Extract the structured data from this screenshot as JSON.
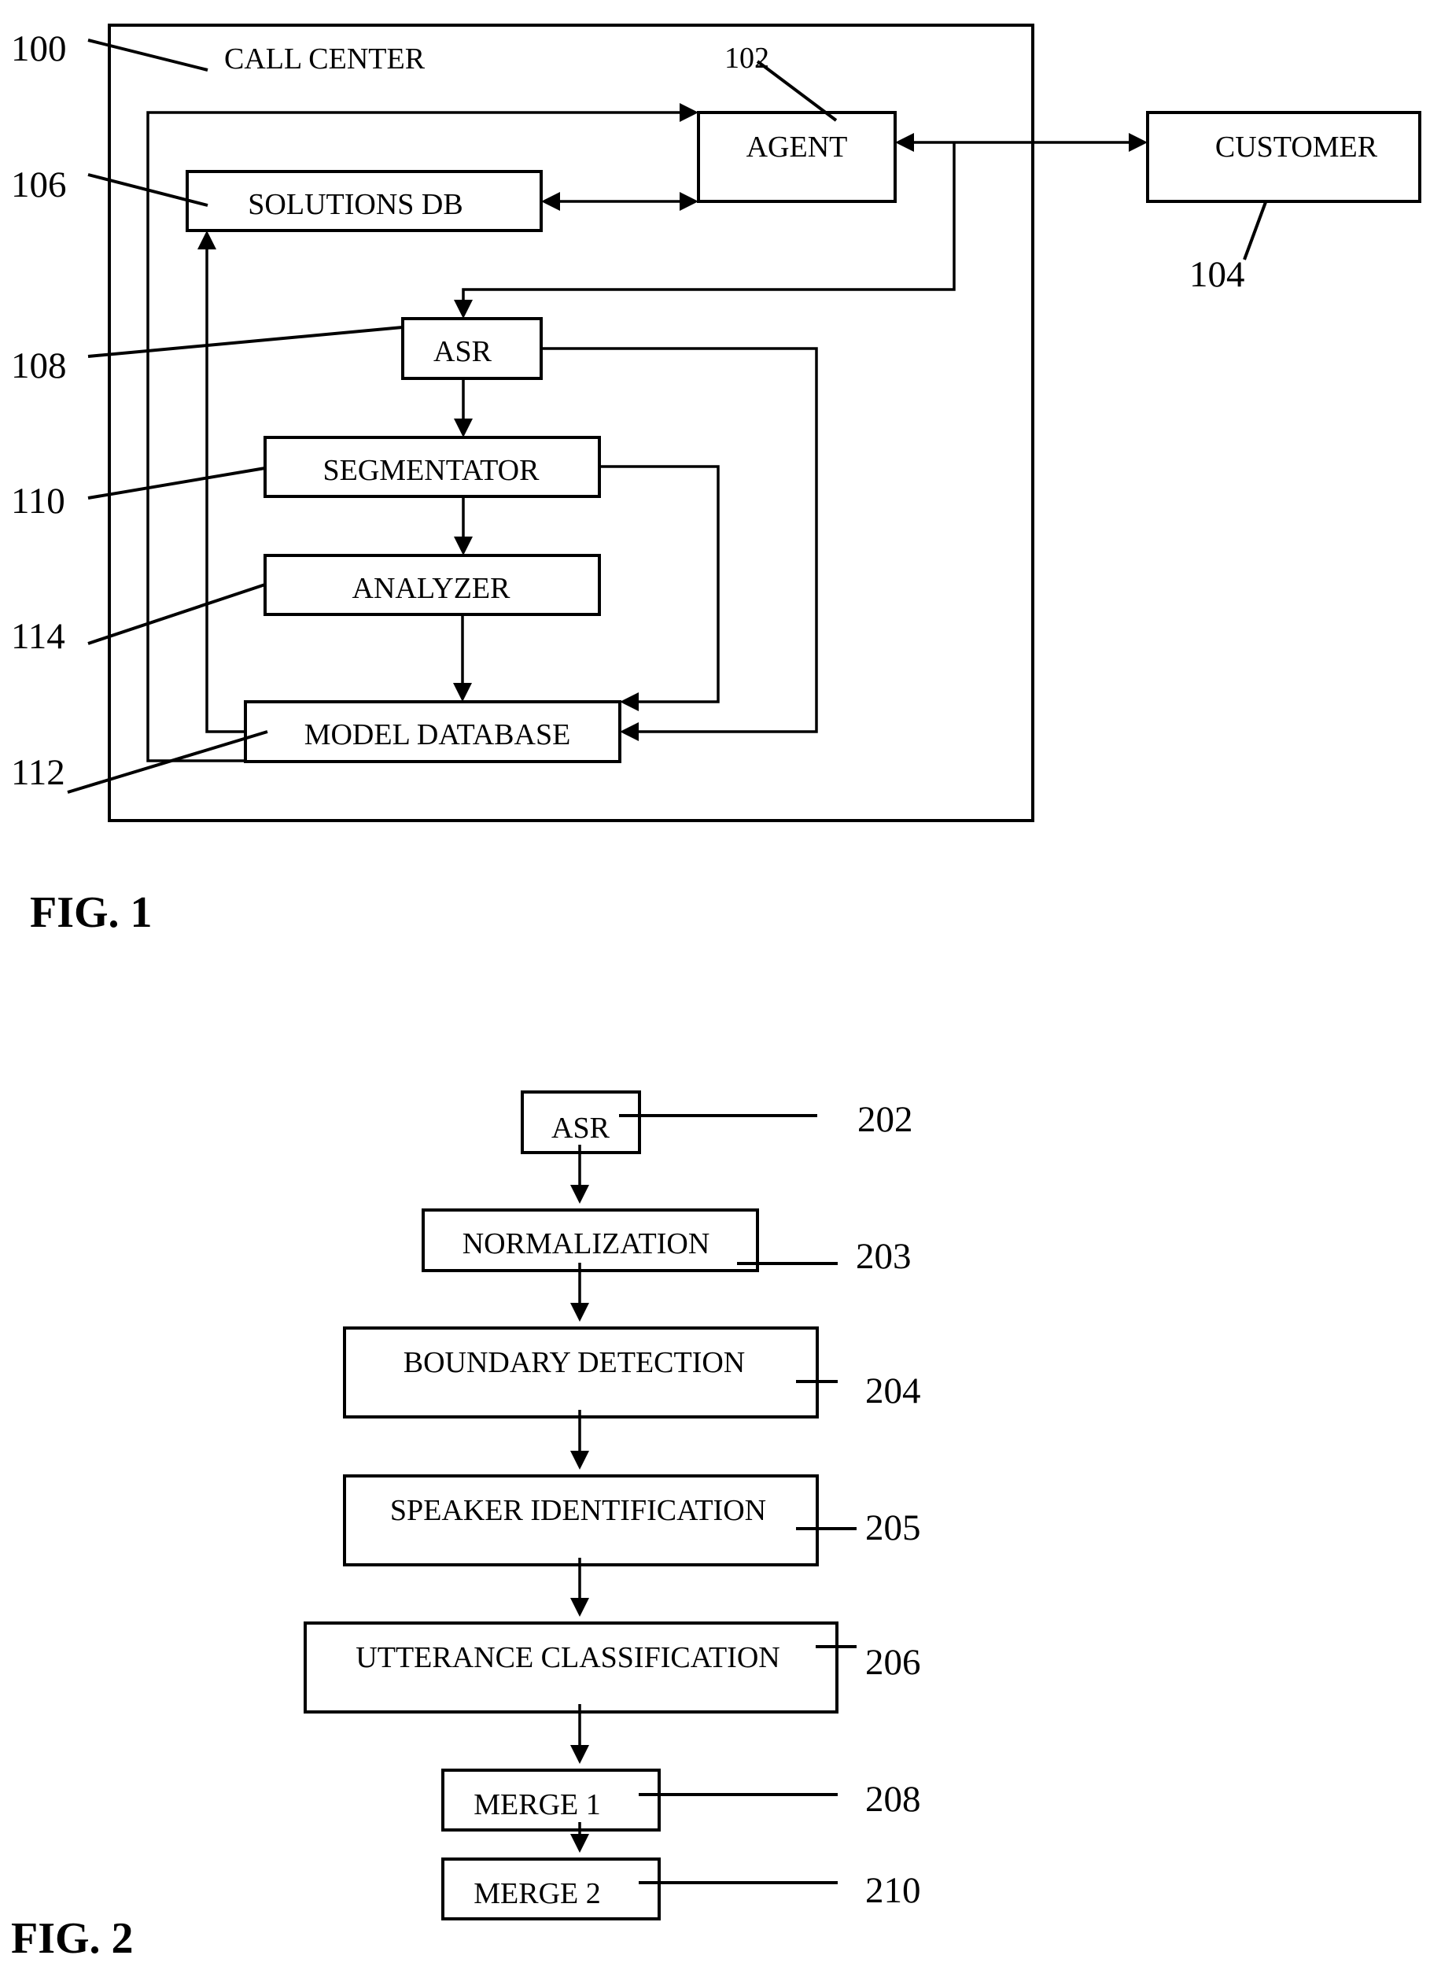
{
  "fig1": {
    "caption": "FIG. 1",
    "container": {
      "label": "CALL CENTER",
      "ref": "100"
    },
    "blocks": {
      "agent": {
        "label": "AGENT",
        "ref": "102"
      },
      "customer": {
        "label": "CUSTOMER",
        "ref": "104"
      },
      "solutions_db": {
        "label": "SOLUTIONS DB",
        "ref": "106"
      },
      "asr": {
        "label": "ASR",
        "ref": "108"
      },
      "segmentator": {
        "label": "SEGMENTATOR",
        "ref": "110"
      },
      "model_database": {
        "label": "MODEL DATABASE",
        "ref": "112"
      },
      "analyzer": {
        "label": "ANALYZER",
        "ref": "114"
      }
    },
    "connections": [
      {
        "from": "agent",
        "to": "customer",
        "direction": "bidirectional"
      },
      {
        "from": "agent",
        "to": "solutions_db",
        "direction": "bidirectional"
      },
      {
        "from": "agent-customer-line",
        "to": "asr",
        "direction": "forward"
      },
      {
        "from": "asr",
        "to": "segmentator",
        "direction": "forward"
      },
      {
        "from": "segmentator",
        "to": "analyzer",
        "direction": "forward"
      },
      {
        "from": "analyzer",
        "to": "model_database",
        "direction": "forward"
      },
      {
        "from": "segmentator",
        "to": "model_database",
        "direction": "forward"
      },
      {
        "from": "asr",
        "to": "model_database",
        "direction": "forward"
      },
      {
        "from": "model_database",
        "to": "solutions_db",
        "direction": "forward"
      },
      {
        "from": "model_database",
        "to": "agent",
        "direction": "forward"
      }
    ]
  },
  "fig2": {
    "caption": "FIG. 2",
    "steps": [
      {
        "id": "asr",
        "label": "ASR",
        "ref": "202"
      },
      {
        "id": "normalization",
        "label": "NORMALIZATION",
        "ref": "203"
      },
      {
        "id": "boundary_detection",
        "label": "BOUNDARY DETECTION",
        "ref": "204"
      },
      {
        "id": "speaker_identification",
        "label": "SPEAKER IDENTIFICATION",
        "ref": "205"
      },
      {
        "id": "utterance_classification",
        "label": "UTTERANCE CLASSIFICATION",
        "ref": "206"
      },
      {
        "id": "merge1",
        "label": "MERGE 1",
        "ref": "208"
      },
      {
        "id": "merge2",
        "label": "MERGE 2",
        "ref": "210"
      }
    ]
  }
}
